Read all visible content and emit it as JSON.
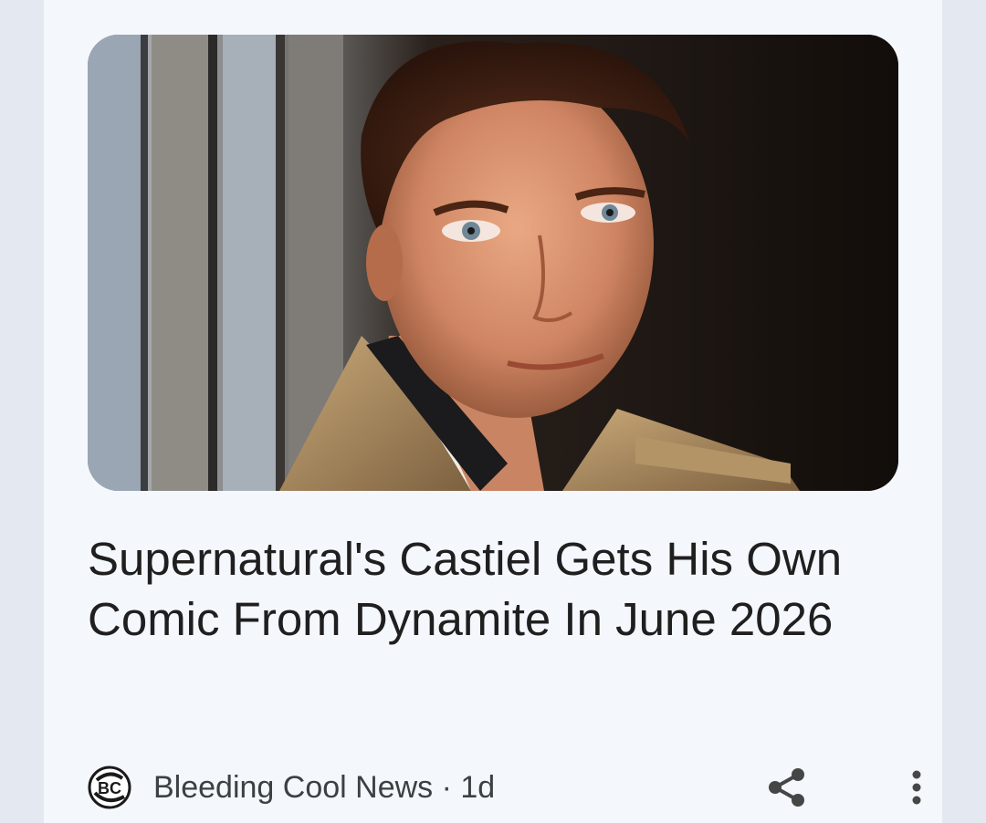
{
  "article": {
    "image_alt": "Castiel portrait",
    "headline": "Supernatural's Castiel Gets His Own Comic From Dynamite In June 2026",
    "source_name": "Bleeding Cool News",
    "separator": "·",
    "age": "1d",
    "source_line": "Bleeding Cool News · 1d",
    "logo_text": "BC"
  },
  "actions": {
    "share_icon": "share-icon",
    "more_icon": "more-vertical-icon"
  },
  "colors": {
    "card_background": "#f4f7fc",
    "page_background": "#e4e9f1",
    "headline_text": "#1f1f1f",
    "meta_text": "#3c4043",
    "icon": "#444746"
  }
}
